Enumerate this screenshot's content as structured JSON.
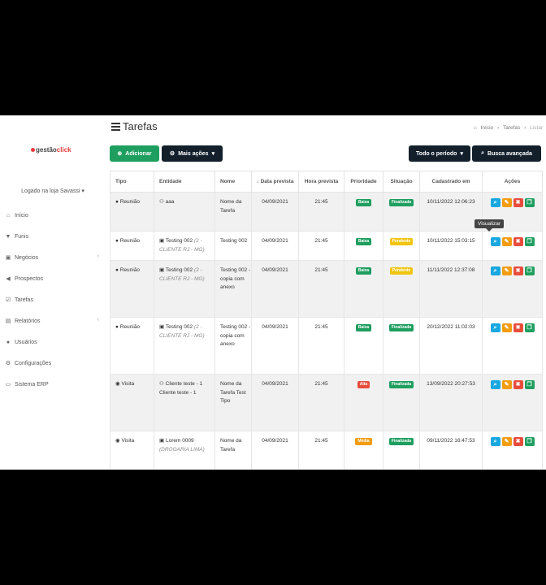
{
  "brand": {
    "logo_text": "gestão",
    "logo_accent": "click"
  },
  "sidebar": {
    "logged_text": "Logado na loja Savassi ▾",
    "items": [
      {
        "label": "Início",
        "icon": "home-icon",
        "glyph": "⌂",
        "chevron": false
      },
      {
        "label": "Funis",
        "icon": "filter-icon",
        "glyph": "▼",
        "chevron": false
      },
      {
        "label": "Negócios",
        "icon": "briefcase-icon",
        "glyph": "▣",
        "chevron": true
      },
      {
        "label": "Prospectos",
        "icon": "bullhorn-icon",
        "glyph": "◀",
        "chevron": false
      },
      {
        "label": "Tarefas",
        "icon": "tasks-icon",
        "glyph": "☑",
        "chevron": false
      },
      {
        "label": "Relatórios",
        "icon": "chart-icon",
        "glyph": "▤",
        "chevron": true
      },
      {
        "label": "Usuários",
        "icon": "user-icon",
        "glyph": "●",
        "chevron": false
      },
      {
        "label": "Configurações",
        "icon": "gears-icon",
        "glyph": "⚙",
        "chevron": false
      },
      {
        "label": "Sistema ERP",
        "icon": "laptop-icon",
        "glyph": "▭",
        "chevron": false
      }
    ]
  },
  "header": {
    "title": "Tarefas",
    "breadcrumb": {
      "home": "Início",
      "section": "Tarefas",
      "current": "Listar"
    }
  },
  "toolbar": {
    "add_label": "Adicionar",
    "more_label": "Mais ações",
    "period_label": "Todo o período",
    "advanced_search_label": "Busca avançada"
  },
  "table": {
    "columns": [
      "Tipo",
      "Entidade",
      "Nome",
      "Data prevista",
      "Hora prevista",
      "Prioridade",
      "Situação",
      "Cadastrado em",
      "Ações"
    ],
    "date_sort_glyph": "↓",
    "rows": [
      {
        "tipo": "Reunião",
        "tipo_glyph": "●",
        "entity_glyph": "⚇",
        "entity": "aaa",
        "entity_sub": "",
        "nome": "Nome da Tarefa",
        "data": "04/09/2021",
        "hora": "21:45",
        "prioridade": "Baixa",
        "situacao": "Finalizada",
        "cadastrado": "10/11/2022 12:06:23"
      },
      {
        "tipo": "Reunião",
        "tipo_glyph": "●",
        "entity_glyph": "▣",
        "entity": "Testing 002",
        "entity_sub": "(2 - CLIENTE RJ - MG)",
        "nome": "Testing 002",
        "data": "04/09/2021",
        "hora": "21:45",
        "prioridade": "Baixa",
        "situacao": "Pendente",
        "cadastrado": "10/11/2022 15:03:15"
      },
      {
        "tipo": "Reunião",
        "tipo_glyph": "●",
        "entity_glyph": "▣",
        "entity": "Testing 002",
        "entity_sub": "(2 - CLIENTE RJ - MG)",
        "nome": "Testing 002 - copia com anexo",
        "data": "04/09/2021",
        "hora": "21:45",
        "prioridade": "Baixa",
        "situacao": "Pendente",
        "cadastrado": "11/11/2022 12:37:08"
      },
      {
        "tipo": "Reunião",
        "tipo_glyph": "●",
        "entity_glyph": "▣",
        "entity": "Testing 002",
        "entity_sub": "(2 - CLIENTE RJ - MG)",
        "nome": "Testing 002 - copia com anexo",
        "data": "04/09/2021",
        "hora": "21:45",
        "prioridade": "Baixa",
        "situacao": "Finalizada",
        "cadastrado": "20/12/2022 11:02:03"
      },
      {
        "tipo": "Visita",
        "tipo_glyph": "◉",
        "entity_glyph": "⚇",
        "entity": "Cliente teste - 1 Cliente teste - 1",
        "entity_sub": "",
        "nome": "Nome da Tarefa Test Tipo",
        "data": "04/09/2021",
        "hora": "21:45",
        "prioridade": "Alta",
        "situacao": "Finalizada",
        "cadastrado": "13/09/2022 20:27:53"
      },
      {
        "tipo": "Visita",
        "tipo_glyph": "◉",
        "entity_glyph": "▣",
        "entity": "Lorem 0009",
        "entity_sub": "(DROGARIA LIMA)",
        "nome": "Nome da Tarefa",
        "data": "04/09/2021",
        "hora": "21:45",
        "prioridade": "Média",
        "situacao": "Finalizada",
        "cadastrado": "09/11/2022 16:47:53"
      }
    ]
  },
  "tooltip": {
    "text": "Visualizar"
  },
  "colors": {
    "Baixa": "#1e9e5f",
    "Alta": "#e74c3c",
    "Média": "#f39c12",
    "Finalizada": "#1e9e5f",
    "Pendente": "#f1c40f"
  }
}
